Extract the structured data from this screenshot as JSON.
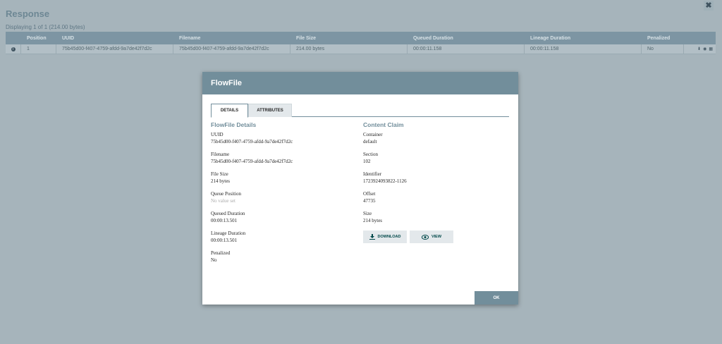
{
  "background": {
    "title": "Response",
    "count_text": "Displaying 1 of 1 (214.00 bytes)",
    "close_glyph": "✖",
    "columns": [
      "",
      "Position",
      "UUID",
      "Filename",
      "File Size",
      "Queued Duration",
      "Lineage Duration",
      "Penalized",
      ""
    ],
    "rows": [
      {
        "position": "1",
        "uuid": "75b45d00-f407-4759-afdd-9a7de42f7d2c",
        "filename": "75b45d00-f407-4759-afdd-9a7de42f7d2c",
        "file_size": "214.00 bytes",
        "queued_duration": "00:00:11.158",
        "lineage_duration": "00:00:11.158",
        "penalized": "No"
      }
    ]
  },
  "modal": {
    "title": "FlowFile",
    "tabs": [
      {
        "label": "DETAILS",
        "active": true
      },
      {
        "label": "ATTRIBUTES",
        "active": false
      }
    ],
    "details": {
      "heading": "FlowFile Details",
      "fields": [
        {
          "label": "UUID",
          "value": "75b45d00-f407-4759-afdd-9a7de42f7d2c"
        },
        {
          "label": "Filename",
          "value": "75b45d00-f407-4759-afdd-9a7de42f7d2c"
        },
        {
          "label": "File Size",
          "value": "214 bytes"
        },
        {
          "label": "Queue Position",
          "value": "No value set"
        },
        {
          "label": "Queued Duration",
          "value": "00:00:13.501"
        },
        {
          "label": "Lineage Duration",
          "value": "00:00:13.501"
        },
        {
          "label": "Penalized",
          "value": "No"
        }
      ]
    },
    "content_claim": {
      "heading": "Content Claim",
      "fields": [
        {
          "label": "Container",
          "value": "default"
        },
        {
          "label": "Section",
          "value": "102"
        },
        {
          "label": "Identifier",
          "value": "1723924093822-1126"
        },
        {
          "label": "Offset",
          "value": "47735"
        },
        {
          "label": "Size",
          "value": "214 bytes"
        }
      ],
      "download_label": "DOWNLOAD",
      "view_label": "VIEW"
    },
    "ok_label": "OK"
  },
  "colors": {
    "header": "#728e9b",
    "accent_text": "#004849",
    "overlay": "#a6b4bb"
  }
}
